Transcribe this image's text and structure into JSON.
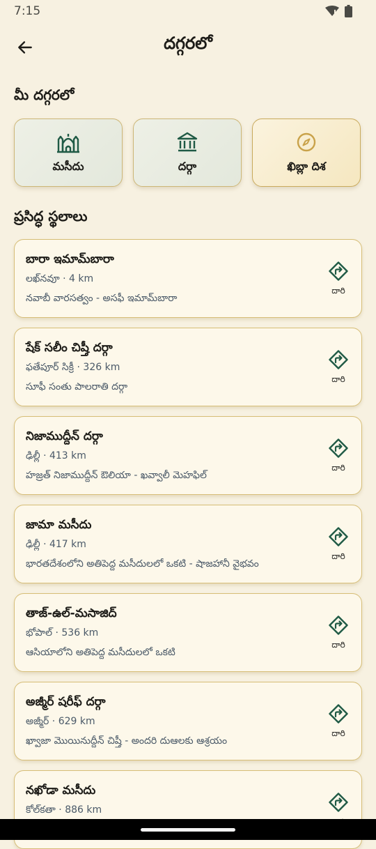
{
  "status": {
    "time": "7:15"
  },
  "header": {
    "title": "దగ్గరలో"
  },
  "nearby": {
    "title": "మీ దగ్గరలో",
    "items": [
      {
        "label": "మసీదు",
        "icon": "mosque-icon"
      },
      {
        "label": "దర్గా",
        "icon": "dargah-icon"
      },
      {
        "label": "ఖిబ్లా దిశ",
        "icon": "compass-icon"
      }
    ]
  },
  "famous": {
    "title": "ప్రసిద్ధ స్థలాలు",
    "direction_label": "దారి",
    "places": [
      {
        "name": "బారా ఇమామ్‌బారా",
        "location": "లఖ్‌నవూ · 4 km",
        "desc": "నవాబీ వారసత్వం - అసఫీ ఇమామ్‌బారా"
      },
      {
        "name": "షేక్ సలీం చిష్తీ దర్గా",
        "location": "ఫతేపూర్ సిక్రీ · 326 km",
        "desc": "సూఫీ సంతు పాలరాతి దర్గా"
      },
      {
        "name": "నిజాముద్దీన్ దర్గా",
        "location": "ఢిల్లీ · 413 km",
        "desc": "హజ్రత్ నిజాముద్దీన్ ఔలియా - ఖవ్వాలీ మెహఫిల్"
      },
      {
        "name": "జామా మసీదు",
        "location": "ఢిల్లీ · 417 km",
        "desc": "భారతదేశంలోని అతిపెద్ద మసీదులలో ఒకటి - షాజహానీ వైభవం"
      },
      {
        "name": "తాజ్-ఉల్-మసాజిద్",
        "location": "భోపాల్ · 536 km",
        "desc": "ఆసియాలోని అతిపెద్ద మసీదులలో ఒకటి"
      },
      {
        "name": "అజ్మీర్ షరీఫ్ దర్గా",
        "location": "అజ్మీర్ · 629 km",
        "desc": "ఖ్వాజా మొయినుద్దీన్ చిష్తీ - అందరి దుఆలకు ఆశ్రయం"
      },
      {
        "name": "నఖోడా మసీదు",
        "location": "కోల్‌కతా · 886 km",
        "desc": ""
      }
    ]
  },
  "colors": {
    "background": "#f7f1e1",
    "accent_green": "#1f5a45",
    "accent_gold": "#c9a24a"
  }
}
